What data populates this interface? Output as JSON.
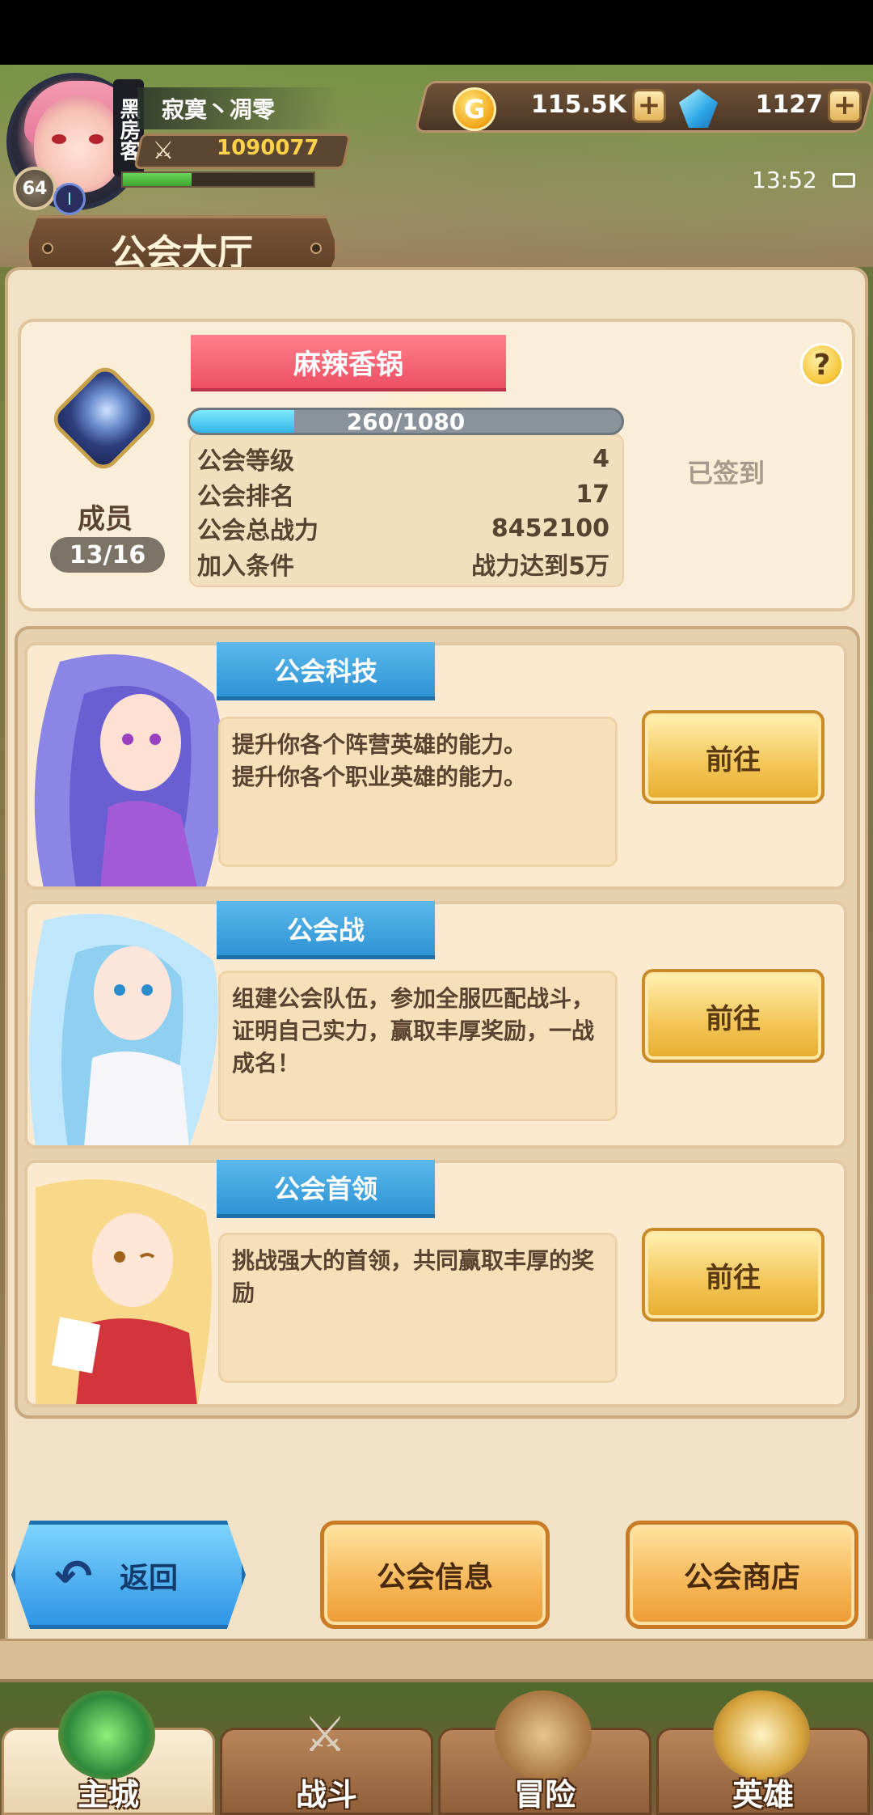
{
  "player": {
    "name": "寂寞丶凋零",
    "level": "64",
    "power": "1090077",
    "avatar_tag": "黑房客",
    "exp_fraction": 0.36
  },
  "currency": {
    "gold": "115.5K",
    "gems": "1127",
    "gold_icon": "coin-icon",
    "gem_icon": "diamond-icon"
  },
  "status": {
    "time": "13:52"
  },
  "page": {
    "title": "公会大厅"
  },
  "guild": {
    "name": "麻辣香锅",
    "xp_text": "260/1080",
    "xp_fraction": 0.2407,
    "members_label": "成员",
    "members_count": "13/16",
    "signed_in": "已签到",
    "help": "?",
    "stats": [
      {
        "label": "公会等级",
        "value": "4"
      },
      {
        "label": "公会排名",
        "value": "17"
      },
      {
        "label": "公会总战力",
        "value": "8452100"
      },
      {
        "label": "加入条件",
        "value": "战力达到5万"
      }
    ]
  },
  "features": [
    {
      "title": "公会科技",
      "desc": "提升你各个阵营英雄的能力。\n提升你各个职业英雄的能力。",
      "button": "前往",
      "accent": "#7b5ad6"
    },
    {
      "title": "公会战",
      "desc": "组建公会队伍，参加全服匹配战斗，证明自己实力，赢取丰厚奖励，一战成名！",
      "button": "前往",
      "accent": "#8fd0f0"
    },
    {
      "title": "公会首领",
      "desc": "挑战强大的首领，共同赢取丰厚的奖励",
      "button": "前往",
      "accent": "#f3c15e"
    }
  ],
  "buttons": {
    "back": "返回",
    "info": "公会信息",
    "shop": "公会商店"
  },
  "nav": [
    {
      "label": "主城",
      "icon": "castle-icon",
      "active": true
    },
    {
      "label": "战斗",
      "icon": "crossed-swords-icon",
      "active": false
    },
    {
      "label": "冒险",
      "icon": "scroll-map-icon",
      "active": false
    },
    {
      "label": "英雄",
      "icon": "hero-crest-icon",
      "active": false
    }
  ],
  "colors": {
    "guild_banner": "#ec5065",
    "feature_title": "#2f93d4",
    "go_button": "#f3c455",
    "back_button": "#2e95e6"
  }
}
